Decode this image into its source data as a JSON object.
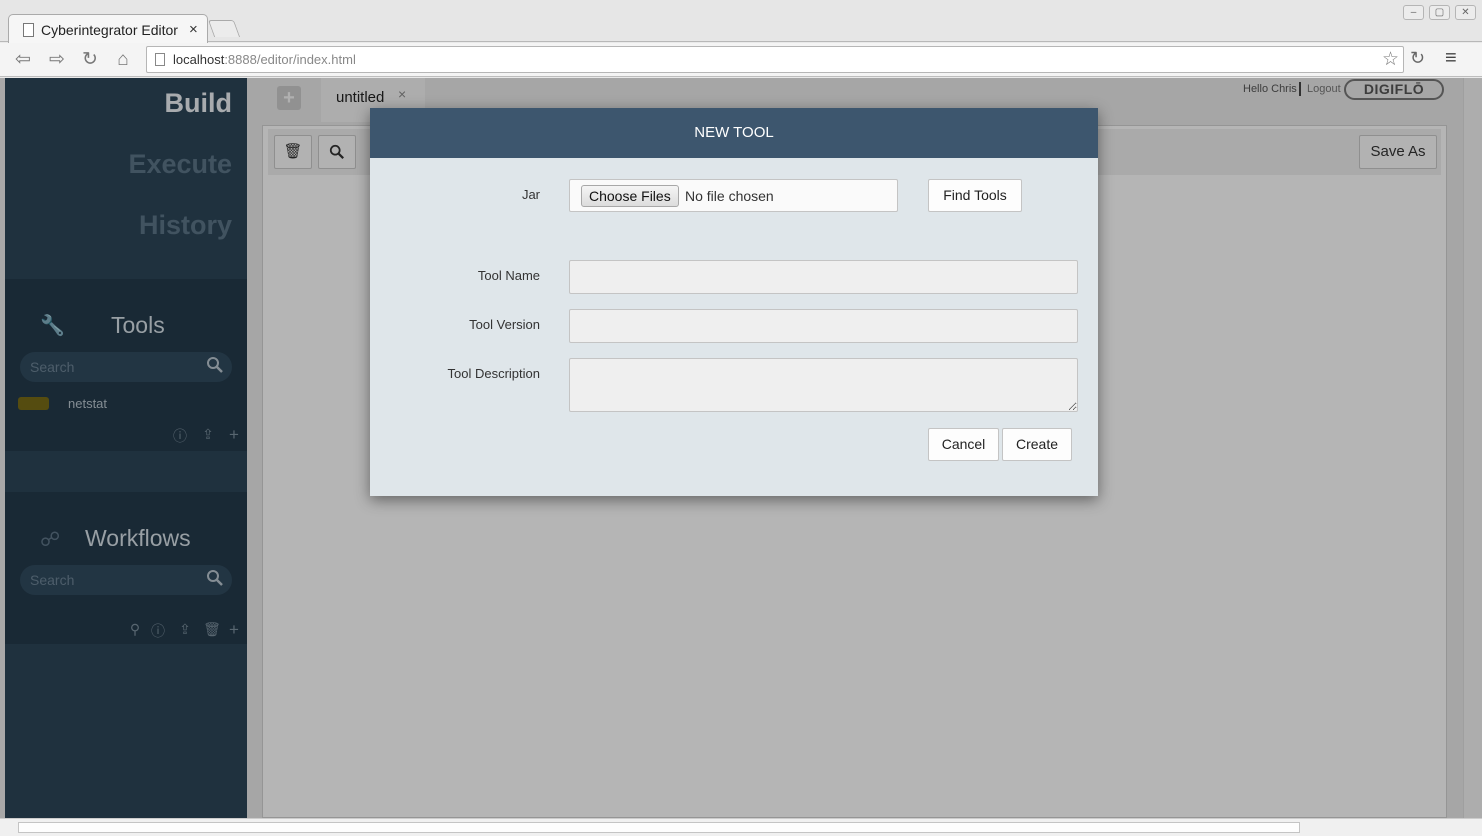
{
  "browser": {
    "tab_title": "Cyberintegrator Editor",
    "tab_close": "×",
    "url_host": "localhost",
    "url_rest": ":8888/editor/index.html",
    "window_controls": [
      "–",
      "▢",
      "✕"
    ],
    "nav_icons": [
      "back-icon",
      "forward-icon",
      "reload-icon",
      "home-icon"
    ]
  },
  "sidebar": {
    "nav": {
      "build": "Build",
      "execute": "Execute",
      "history": "History",
      "active": "Build"
    },
    "tools_panel": {
      "title": "Tools",
      "search_placeholder": "Search",
      "items": [
        {
          "label": "netstat",
          "color": "#766a17"
        }
      ],
      "actions": [
        "info-icon",
        "share-icon",
        "add-icon"
      ]
    },
    "workflows_panel": {
      "title": "Workflows",
      "search_placeholder": "Search",
      "actions": [
        "pin-icon",
        "info-icon",
        "share-icon",
        "trash-icon",
        "add-icon"
      ]
    }
  },
  "header": {
    "greeting": "Hello Chris",
    "logout": "Logout",
    "brand": "DIGIFLŌ"
  },
  "editor": {
    "add_tab": "+",
    "tab_label": "untitled",
    "tab_close": "×",
    "save_as": "Save As"
  },
  "modal": {
    "title": "NEW TOOL",
    "jar_label": "Jar",
    "choose_files": "Choose Files",
    "file_status": "No file chosen",
    "find_tools": "Find Tools",
    "tool_name_label": "Tool Name",
    "tool_name_value": "",
    "tool_version_label": "Tool Version",
    "tool_version_value": "",
    "tool_description_label": "Tool Description",
    "tool_description_value": "",
    "cancel": "Cancel",
    "create": "Create"
  },
  "colors": {
    "sidebar_bg": "#2c4557",
    "modal_header": "#3d566e",
    "modal_body": "#dfe6ea"
  }
}
